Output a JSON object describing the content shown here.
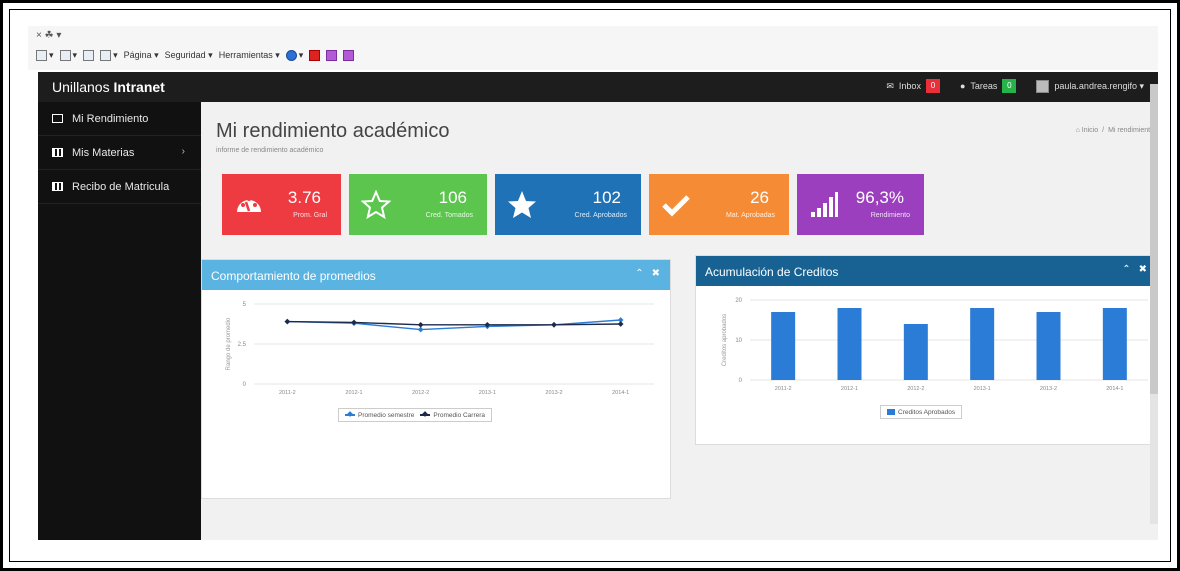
{
  "browser": {
    "toolbar": {
      "pagina": "Página ▾",
      "seguridad": "Seguridad ▾",
      "herramientas": "Herramientas ▾"
    }
  },
  "app": {
    "brand_light": "Unillanos ",
    "brand_bold": "Intranet"
  },
  "topbar": {
    "inbox_label": "Inbox",
    "inbox_count": "0",
    "tareas_label": "Tareas",
    "tareas_count": "0",
    "user": "paula.andrea.rengifo ▾"
  },
  "sidebar": {
    "items": [
      {
        "label": "Mi Rendimiento"
      },
      {
        "label": "Mis Materias",
        "chevron": "›"
      },
      {
        "label": "Recibo de Matricula"
      }
    ]
  },
  "page": {
    "title": "Mi rendimiento académico",
    "subtitle": "informe de rendimiento académico",
    "breadcrumb_home": "Inicio",
    "breadcrumb_sep": "/",
    "breadcrumb_current": "Mi rendimiento"
  },
  "stats": [
    {
      "value": "3.76",
      "label": "Prom. Gral",
      "color": "#ee3a41",
      "icon": "dashboard-icon"
    },
    {
      "value": "106",
      "label": "Cred. Tomados",
      "color": "#5cc54e",
      "icon": "star-outline-icon"
    },
    {
      "value": "102",
      "label": "Cred. Aprobados",
      "color": "#1f72b6",
      "icon": "star-icon"
    },
    {
      "value": "26",
      "label": "Mat. Aprobadas",
      "color": "#f58c35",
      "icon": "check-icon"
    },
    {
      "value": "96,3%",
      "label": "Rendimiento",
      "color": "#9b3fbf",
      "icon": "signal-bars-icon"
    }
  ],
  "panels": {
    "promedios": {
      "title": "Comportamiento de promedios",
      "collapse": "⌃",
      "close": "✖"
    },
    "creditos": {
      "title": "Acumulación de Creditos",
      "collapse": "⌃",
      "close": "✖"
    }
  },
  "chart_data": [
    {
      "type": "line",
      "title": "",
      "xlabel": "",
      "ylabel": "Rango de promedio",
      "categories": [
        "2011-2",
        "2012-1",
        "2012-2",
        "2013-1",
        "2013-2",
        "2014-1"
      ],
      "ylim": [
        0,
        5
      ],
      "yticks": [
        "0",
        "2.5",
        "5"
      ],
      "grid": true,
      "legend": "bottom",
      "series": [
        {
          "name": "Promedio semestre",
          "color": "#2b7cd6",
          "values": [
            3.9,
            3.8,
            3.4,
            3.6,
            3.7,
            4.0
          ]
        },
        {
          "name": "Promedio Carrera",
          "color": "#1d2b4a",
          "values": [
            3.9,
            3.85,
            3.7,
            3.7,
            3.7,
            3.75
          ]
        }
      ]
    },
    {
      "type": "bar",
      "title": "",
      "xlabel": "",
      "ylabel": "Creditos aprobados",
      "categories": [
        "2011-2",
        "2012-1",
        "2012-2",
        "2013-1",
        "2013-2",
        "2014-1"
      ],
      "ylim": [
        0,
        20
      ],
      "yticks": [
        "0",
        "10",
        "20"
      ],
      "grid": true,
      "legend": "bottom",
      "series": [
        {
          "name": "Creditos Aprobados",
          "color": "#2b7cd6",
          "values": [
            17,
            18,
            14,
            18,
            17,
            18
          ]
        }
      ]
    }
  ]
}
